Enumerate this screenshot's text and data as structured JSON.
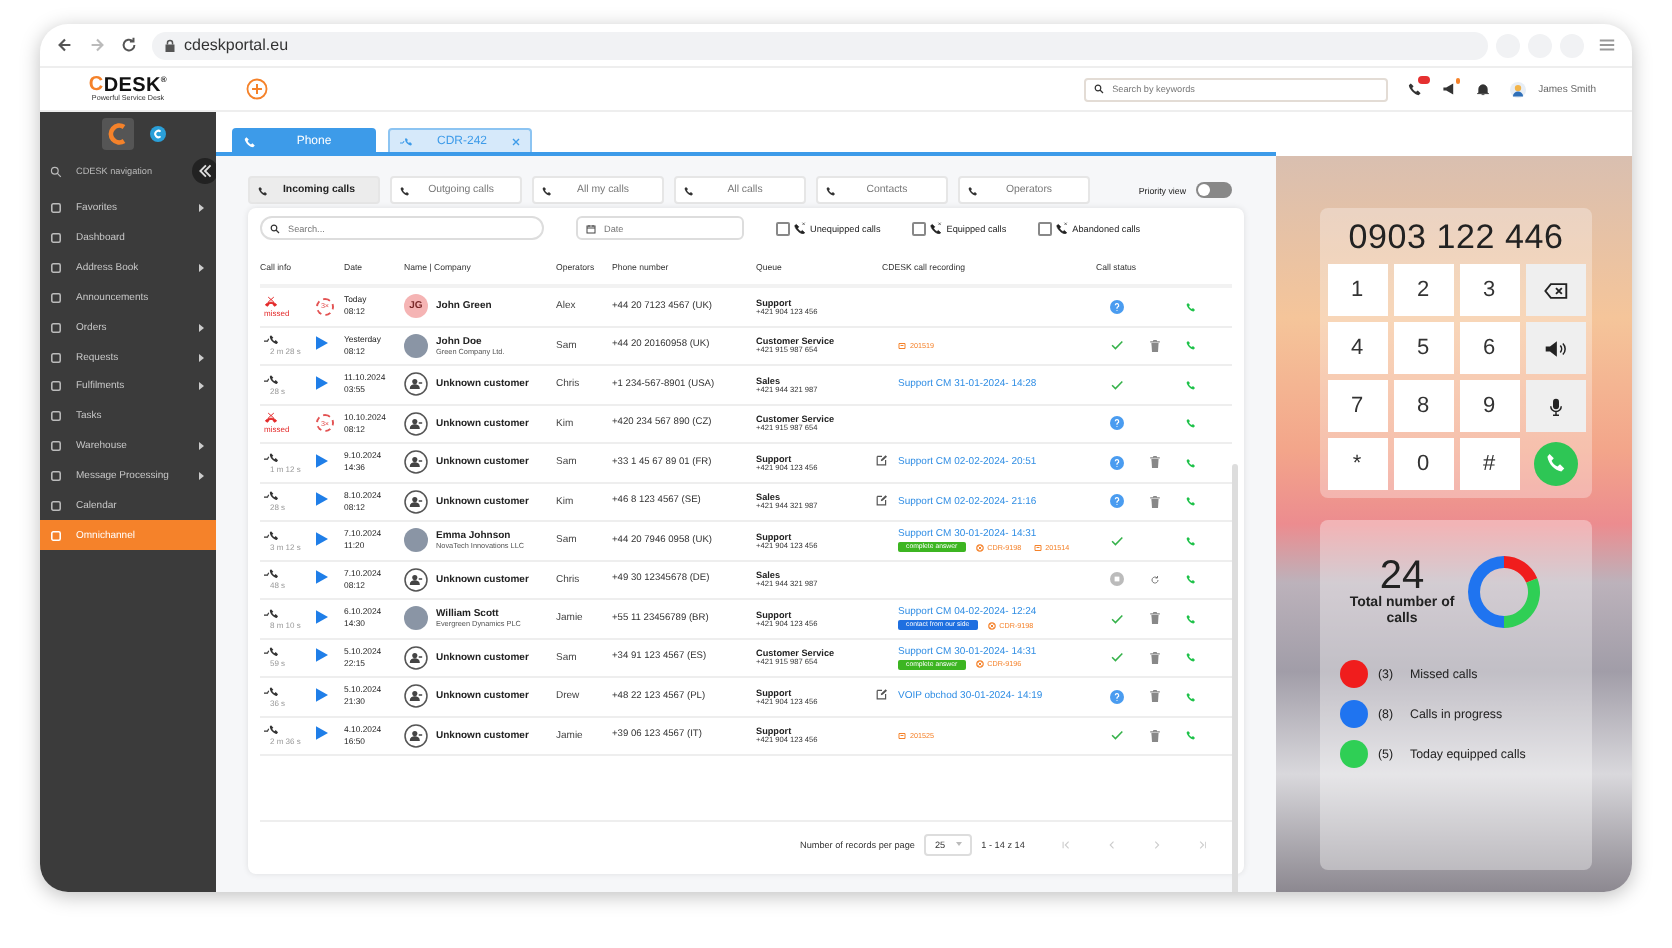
{
  "browser": {
    "url": "cdeskportal.eu"
  },
  "header": {
    "logo": "CDESK$^{®}$",
    "tagline": "Powerful Service Desk",
    "search_placeholder": "Search by keywords",
    "user": "James Smith"
  },
  "sidebar": {
    "nav_label": "CDESK navigation",
    "items": [
      {
        "label": "Favorites",
        "submenu": true,
        "selected": false
      },
      {
        "label": "Dashboard",
        "submenu": false,
        "selected": false
      },
      {
        "label": "Address Book",
        "submenu": true,
        "selected": false
      },
      {
        "label": "Announcements",
        "submenu": false,
        "selected": false
      },
      {
        "label": "Orders",
        "submenu": true,
        "selected": false
      },
      {
        "label": "Requests",
        "submenu": true,
        "selected": false
      },
      {
        "label": "Fulfilments",
        "submenu": true,
        "selected": false
      },
      {
        "label": "Tasks",
        "submenu": false,
        "selected": false
      },
      {
        "label": "Warehouse",
        "submenu": true,
        "selected": false
      },
      {
        "label": "Message Processing",
        "submenu": true,
        "selected": false
      },
      {
        "label": "Calendar",
        "submenu": false,
        "selected": false
      },
      {
        "label": "Omnichannel",
        "submenu": false,
        "selected": true
      }
    ]
  },
  "tabs": [
    {
      "label": "Phone",
      "selected": true,
      "closable": false
    },
    {
      "label": "CDR-242",
      "selected": false,
      "closable": true
    }
  ],
  "filters": [
    {
      "label": "Incoming calls",
      "selected": true
    },
    {
      "label": "Outgoing calls",
      "selected": false
    },
    {
      "label": "All my calls",
      "selected": false
    },
    {
      "label": "All calls",
      "selected": false
    },
    {
      "label": "Contacts",
      "selected": false
    },
    {
      "label": "Operators",
      "selected": false
    }
  ],
  "priority_view": {
    "label": "Priority view",
    "on": false
  },
  "search": {
    "placeholder": "Search..."
  },
  "date": {
    "placeholder": "Date"
  },
  "checkboxes": [
    {
      "label": "Unequipped calls",
      "checked": false
    },
    {
      "label": "Equipped calls",
      "checked": false
    },
    {
      "label": "Abandoned calls",
      "checked": false
    }
  ],
  "table": {
    "columns": [
      "Call info",
      "Date",
      "Name | Company",
      "Operators",
      "Phone number",
      "Queue",
      "CDESK call recording",
      "Call status"
    ],
    "rows": [
      {
        "kind": "missed",
        "label": "missed",
        "repeat": "3×",
        "date": "Today",
        "time": "08:12",
        "avatar": {
          "kind": "initials",
          "initials": "JG"
        },
        "name": "John Green",
        "operator": "Alex",
        "phone": "+44 20 7123 4567 (UK)",
        "queue": "Support",
        "queue_phone": "+421 904 123 456",
        "status": {
          "kind": "pending"
        },
        "delete": false
      },
      {
        "kind": "incoming",
        "duration": "2 m 28 s",
        "date": "Yesterday",
        "time": "08:12",
        "avatar": {
          "kind": "photo"
        },
        "name": "John Doe",
        "company": "Green Company Ltd.",
        "operator": "Sam",
        "phone": "+44 20 20160958 (UK)",
        "queue": "Customer Service",
        "queue_phone": "+421 915 987 654",
        "ticket": "201519",
        "status": {
          "kind": "done"
        },
        "delete": true
      },
      {
        "kind": "incoming",
        "duration": "28 s",
        "date": "11.10.2024",
        "time": "03:55",
        "avatar": {
          "kind": "unknown"
        },
        "name": "Unknown customer",
        "operator": "Chris",
        "phone": "+1 234-567-8901 (USA)",
        "queue": "Sales",
        "queue_phone": "+421 944 321 987",
        "recording": "Support CM 31-01-2024- 14:28",
        "status": {
          "kind": "done"
        },
        "delete": false
      },
      {
        "kind": "missed",
        "label": "missed",
        "repeat": "3×",
        "date": "10.10.2024",
        "time": "08:12",
        "avatar": {
          "kind": "unknown"
        },
        "name": "Unknown customer",
        "operator": "Kim",
        "phone": "+420 234 567 890 (CZ)",
        "queue": "Customer Service",
        "queue_phone": "+421 915 987 654",
        "status": {
          "kind": "pending"
        },
        "delete": false
      },
      {
        "kind": "incoming",
        "duration": "1 m 12 s",
        "date": "9.10.2024",
        "time": "14:36",
        "avatar": {
          "kind": "unknown"
        },
        "name": "Unknown customer",
        "operator": "Sam",
        "phone": "+33 1 45 67 89 01 (FR)",
        "queue": "Support",
        "queue_phone": "+421 904 123 456",
        "note": true,
        "recording": "Support CM 02-02-2024- 20:51",
        "status": {
          "kind": "pending"
        },
        "delete": true
      },
      {
        "kind": "incoming",
        "duration": "28 s",
        "date": "8.10.2024",
        "time": "08:12",
        "avatar": {
          "kind": "unknown"
        },
        "name": "Unknown customer",
        "operator": "Kim",
        "phone": "+46 8 123 4567 (SE)",
        "queue": "Sales",
        "queue_phone": "+421 944 321 987",
        "note": true,
        "recording": "Support CM 02-02-2024- 21:16",
        "status": {
          "kind": "pending"
        },
        "delete": true
      },
      {
        "kind": "incoming",
        "duration": "3 m 12 s",
        "date": "7.10.2024",
        "time": "11:20",
        "avatar": {
          "kind": "photo"
        },
        "name": "Emma Johnson",
        "company": "NovaTech Innovations LLC",
        "operator": "Sam",
        "phone": "+44 20 7946 0958 (UK)",
        "queue": "Support",
        "queue_phone": "+421 904 123 456",
        "recording": "Support CM 30-01-2024- 14:31",
        "tag": {
          "label": "complete answer",
          "color": "#3cb521"
        },
        "cdr": "CDR-9198",
        "ticket": "201514",
        "status": {
          "kind": "done"
        },
        "delete": false
      },
      {
        "kind": "incoming",
        "duration": "48 s",
        "date": "7.10.2024",
        "time": "08:12",
        "avatar": {
          "kind": "unknown"
        },
        "name": "Unknown customer",
        "operator": "Chris",
        "phone": "+49 30 12345678 (DE)",
        "queue": "Sales",
        "queue_phone": "+421 944 321 987",
        "status": {
          "kind": "stopped"
        },
        "refresh": true,
        "delete": false
      },
      {
        "kind": "incoming",
        "duration": "8 m 10 s",
        "date": "6.10.2024",
        "time": "14:30",
        "avatar": {
          "kind": "photo"
        },
        "name": "William Scott",
        "company": "Evergreen Dynamics PLC",
        "operator": "Jamie",
        "phone": "+55 11 23456789 (BR)",
        "queue": "Support",
        "queue_phone": "+421 904 123 456",
        "recording": "Support CM 04-02-2024- 12:24",
        "tag": {
          "label": "contact from our side",
          "color": "#1f6fe0"
        },
        "cdr": "CDR-9198",
        "status": {
          "kind": "done"
        },
        "delete": true
      },
      {
        "kind": "incoming",
        "duration": "59 s",
        "date": "5.10.2024",
        "time": "22:15",
        "avatar": {
          "kind": "unknown"
        },
        "name": "Unknown customer",
        "operator": "Sam",
        "phone": "+34 91 123 4567 (ES)",
        "queue": "Customer Service",
        "queue_phone": "+421 915 987 654",
        "recording": "Support CM 30-01-2024- 14:31",
        "tag": {
          "label": "complete answer",
          "color": "#3cb521"
        },
        "cdr": "CDR-9196",
        "status": {
          "kind": "done"
        },
        "delete": true
      },
      {
        "kind": "incoming",
        "duration": "36 s",
        "date": "5.10.2024",
        "time": "21:30",
        "avatar": {
          "kind": "unknown"
        },
        "name": "Unknown customer",
        "operator": "Drew",
        "phone": "+48 22 123 4567 (PL)",
        "queue": "Support",
        "queue_phone": "+421 904 123 456",
        "note": true,
        "recording": "VOIP obchod 30-01-2024- 14:19",
        "status": {
          "kind": "pending"
        },
        "delete": true
      },
      {
        "kind": "incoming",
        "duration": "2 m 36 s",
        "date": "4.10.2024",
        "time": "16:50",
        "avatar": {
          "kind": "unknown"
        },
        "name": "Unknown customer",
        "operator": "Jamie",
        "phone": "+39 06 123 4567 (IT)",
        "queue": "Support",
        "queue_phone": "+421 904 123 456",
        "ticket": "201525",
        "status": {
          "kind": "done"
        },
        "delete": true
      }
    ]
  },
  "pagination": {
    "label": "Number of records per page",
    "per_page": "25",
    "range": "1 - 14 z 14"
  },
  "dialer": {
    "number": "0903 122 446",
    "keys": [
      "1",
      "2",
      "3",
      "4",
      "5",
      "6",
      "7",
      "8",
      "9",
      "*",
      "0",
      "#"
    ]
  },
  "stats": {
    "total": "24",
    "total_label": "Total number of calls",
    "chart_data": {
      "type": "donut",
      "categories": [
        "Missed calls",
        "Calls in progress",
        "Today equipped calls"
      ],
      "series": [
        {
          "values": [
            18.75,
            50,
            31.25
          ]
        }
      ],
      "colors": [
        "#f01d1d",
        "#1f74f0",
        "#2fcf55"
      ]
    },
    "legend": [
      {
        "count": "(3)",
        "color": "#f01d1d"
      },
      {
        "count": "(8)",
        "color": "#1f74f0"
      },
      {
        "count": "(5)",
        "color": "#2fcf55"
      }
    ]
  }
}
